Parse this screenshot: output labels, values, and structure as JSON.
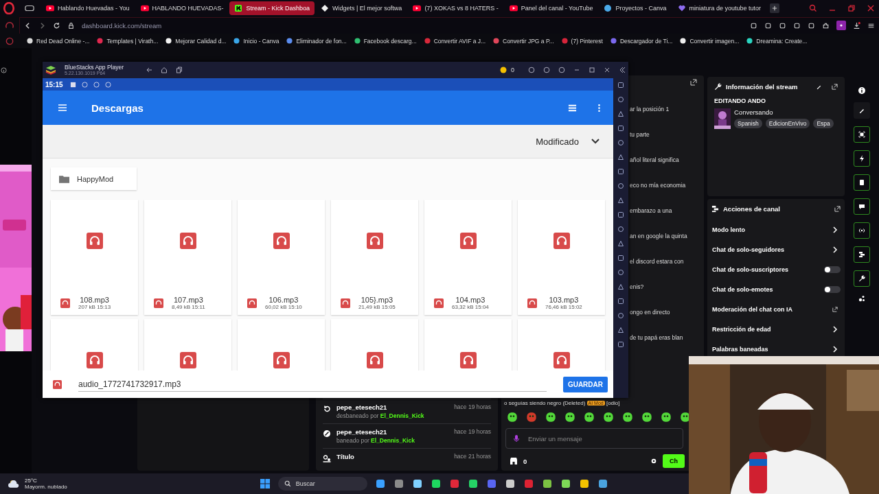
{
  "browser": {
    "tabs": [
      {
        "title": "Hablando Huevadas - You",
        "kind": "youtube",
        "selected": false
      },
      {
        "title": "HABLANDO HUEVADAS-",
        "kind": "youtube",
        "selected": false
      },
      {
        "title": "Stream - Kick Dashboa",
        "kind": "kick",
        "selected": true
      },
      {
        "title": "Widgets | El mejor softwa",
        "kind": "widgets",
        "selected": false
      },
      {
        "title": "(7) XOKAS vs 8 HATERS -",
        "kind": "youtube",
        "selected": false
      },
      {
        "title": "Panel del canal - YouTube",
        "kind": "youtube",
        "selected": false
      },
      {
        "title": "Proyectos - Canva",
        "kind": "canva",
        "selected": false
      },
      {
        "title": "miniatura de youtube tutor",
        "kind": "heart",
        "selected": false
      }
    ],
    "url": "dashboard.kick.com/stream",
    "bookmarks": [
      {
        "title": "Red Dead Online -...",
        "color": "#d9d9d9"
      },
      {
        "title": "Templates | Virath...",
        "color": "#e0284f"
      },
      {
        "title": "Mejorar Calidad d...",
        "color": "#f2f2f2"
      },
      {
        "title": "Inicio - Canva",
        "color": "#3aa6e8"
      },
      {
        "title": "Eliminador de fon...",
        "color": "#5b8def"
      },
      {
        "title": "Facebook descarg...",
        "color": "#2fbf71"
      },
      {
        "title": "Convertir AVIF a J...",
        "color": "#d8283a"
      },
      {
        "title": "Convertir JPG a P...",
        "color": "#e0465a"
      },
      {
        "title": "(7) Pinterest",
        "color": "#d6243a"
      },
      {
        "title": "Descargador de Ti...",
        "color": "#7b68ee"
      },
      {
        "title": "Convertir imagen...",
        "color": "#eeeeee"
      },
      {
        "title": "Dreamina: Create...",
        "color": "#2ad4c0"
      }
    ]
  },
  "emulator": {
    "title": "BlueStacks App Player",
    "version": "5.22.130.1019 P64",
    "coins": "0",
    "time": "15:15",
    "app_title": "Descargas",
    "sort_label": "Modificado",
    "folder": "HappyMod",
    "files": [
      {
        "name": "108.mp3",
        "meta": "207 kB 15:13"
      },
      {
        "name": "107.mp3",
        "meta": "8,49 kB 15:11"
      },
      {
        "name": "106.mp3",
        "meta": "60,02 kB 15:10"
      },
      {
        "name": "105}.mp3",
        "meta": "21,49 kB 15:05"
      },
      {
        "name": "104.mp3",
        "meta": "63,32 kB 15:04"
      },
      {
        "name": "103.mp3",
        "meta": "76,46 kB 15:02"
      }
    ],
    "save_bar": {
      "filename": "audio_1772741732917.mp3",
      "button": "GUARDAR"
    }
  },
  "chat": {
    "messages": [
      "ar la posición 1",
      "tu parte",
      "añol literal significa",
      "eco no mía economia",
      "embarazo a una",
      "an en google la quinta",
      "el discord estara con",
      "enis?",
      "ongo en directo",
      "de tu papá eras blan"
    ],
    "last_message": {
      "text": "o seguías siendo negro (Deleted)",
      "badge": "AI Mod",
      "tag": "[odio]"
    },
    "placeholder": "Enviar un mensaje",
    "points": "0",
    "send_button": "Ch"
  },
  "mod_log": {
    "entries": [
      {
        "kind": "unban",
        "user": "pepe_etesech21",
        "action": "desbaneado por",
        "moderator": "El_Dennis_Kick",
        "time": "hace 19 horas"
      },
      {
        "kind": "ban",
        "user": "pepe_etesech21",
        "action": "baneado por",
        "moderator": "El_Dennis_Kick",
        "time": "hace 19 horas"
      },
      {
        "kind": "title",
        "user": "Título",
        "time": "hace 21 horas"
      }
    ]
  },
  "stream_info": {
    "heading": "Información del stream",
    "title": "EDITANDO ANDO",
    "category": "Conversando",
    "tags": [
      "Spanish",
      "EdicionEnVivo",
      "Espa"
    ]
  },
  "channel_actions": {
    "heading": "Acciones de canal",
    "items": [
      {
        "label": "Modo lento",
        "kind": "link"
      },
      {
        "label": "Chat de solo-seguidores",
        "kind": "link"
      },
      {
        "label": "Chat de solo-suscriptores",
        "kind": "toggle",
        "on": false
      },
      {
        "label": "Chat de solo-emotes",
        "kind": "toggle",
        "on": false
      },
      {
        "label": "Moderación del chat con IA",
        "kind": "external"
      },
      {
        "label": "Restricción de edad",
        "kind": "link"
      },
      {
        "label": "Palabras baneadas",
        "kind": "link"
      }
    ]
  },
  "taskbar": {
    "temperature": "25°C",
    "weather": "Mayorm. nublado",
    "search_placeholder": "Buscar"
  }
}
